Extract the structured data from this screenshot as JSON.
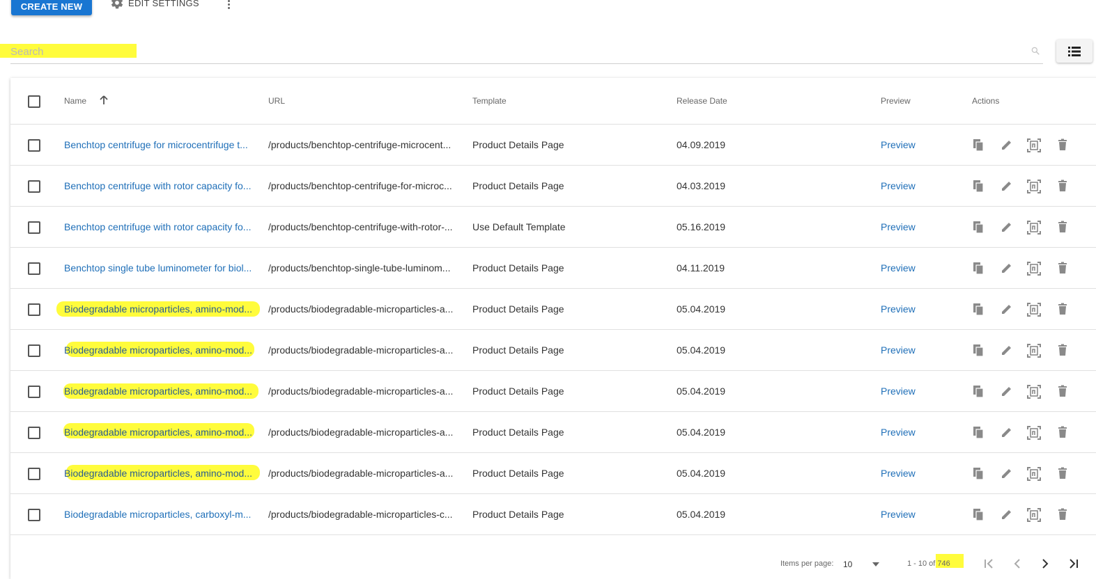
{
  "toolbar": {
    "create_label": "CREATE NEW",
    "settings_label": "EDIT SETTINGS"
  },
  "search": {
    "placeholder": "Search"
  },
  "table": {
    "headers": {
      "name": "Name",
      "url": "URL",
      "template": "Template",
      "release_date": "Release Date",
      "preview": "Preview",
      "actions": "Actions"
    },
    "sort": {
      "column": "Name",
      "direction": "ascending"
    },
    "rows": [
      {
        "name": "Benchtop centrifuge for microcentrifuge t...",
        "url": "/products/benchtop-centrifuge-microcent...",
        "template": "Product Details Page",
        "release_date": "04.09.2019",
        "preview": "Preview"
      },
      {
        "name": "Benchtop centrifuge with rotor capacity fo...",
        "url": "/products/benchtop-centrifuge-for-microc...",
        "template": "Product Details Page",
        "release_date": "04.03.2019",
        "preview": "Preview"
      },
      {
        "name": "Benchtop centrifuge with rotor capacity fo...",
        "url": "/products/benchtop-centrifuge-with-rotor-...",
        "template": "Use Default Template",
        "release_date": "05.16.2019",
        "preview": "Preview"
      },
      {
        "name": "Benchtop single tube luminometer for biol...",
        "url": "/products/benchtop-single-tube-luminom...",
        "template": "Product Details Page",
        "release_date": "04.11.2019",
        "preview": "Preview"
      },
      {
        "name": "Biodegradable microparticles, amino-mod...",
        "url": "/products/biodegradable-microparticles-a...",
        "template": "Product Details Page",
        "release_date": "05.04.2019",
        "preview": "Preview"
      },
      {
        "name": "Biodegradable microparticles, amino-mod...",
        "url": "/products/biodegradable-microparticles-a...",
        "template": "Product Details Page",
        "release_date": "05.04.2019",
        "preview": "Preview"
      },
      {
        "name": "Biodegradable microparticles, amino-mod...",
        "url": "/products/biodegradable-microparticles-a...",
        "template": "Product Details Page",
        "release_date": "05.04.2019",
        "preview": "Preview"
      },
      {
        "name": "Biodegradable microparticles, amino-mod...",
        "url": "/products/biodegradable-microparticles-a...",
        "template": "Product Details Page",
        "release_date": "05.04.2019",
        "preview": "Preview"
      },
      {
        "name": "Biodegradable microparticles, amino-mod...",
        "url": "/products/biodegradable-microparticles-a...",
        "template": "Product Details Page",
        "release_date": "05.04.2019",
        "preview": "Preview"
      },
      {
        "name": "Biodegradable microparticles, carboxyl-m...",
        "url": "/products/biodegradable-microparticles-c...",
        "template": "Product Details Page",
        "release_date": "05.04.2019",
        "preview": "Preview"
      }
    ],
    "highlighted_rows": [
      4,
      5,
      6,
      7,
      8
    ]
  },
  "pagination": {
    "items_per_page_label": "Items per page:",
    "items_per_page_value": "10",
    "range_prefix": "1 - 10 of",
    "total": "746"
  },
  "icons": {
    "action_icons": [
      "copy-icon",
      "edit-icon",
      "translate-icon",
      "delete-icon"
    ],
    "pager_icons": [
      "first-page-icon",
      "previous-page-icon",
      "next-page-icon",
      "last-page-icon"
    ]
  },
  "colors": {
    "primary": "#1976d2",
    "link": "#1f6fb8",
    "highlight": "#fffc3c"
  }
}
